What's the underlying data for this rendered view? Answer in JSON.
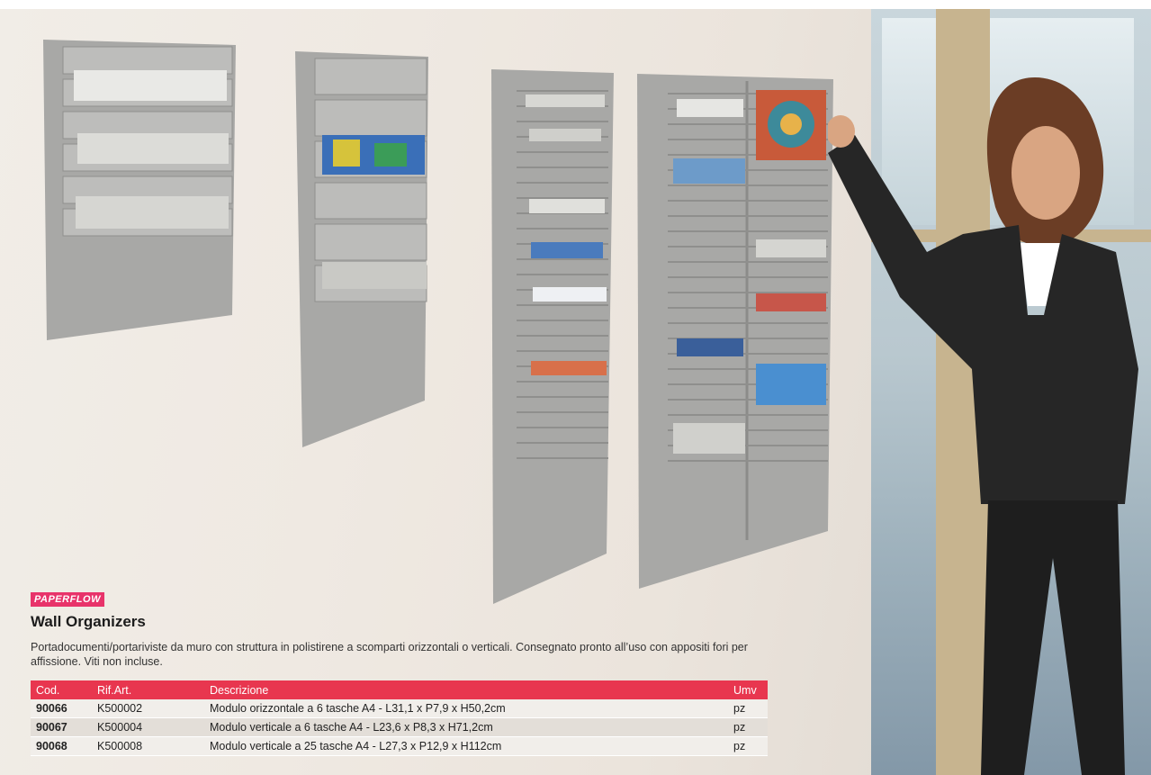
{
  "brand": "PAPERFLOW",
  "title": "Wall Organizers",
  "description": "Portadocumenti/portariviste da muro con struttura in polistirene a scomparti orizzontali o verticali. Consegnato pronto all’uso con appositi fori per affissione. Viti non incluse.",
  "table": {
    "headers": {
      "cod": "Cod.",
      "rif": "Rif.Art.",
      "desc": "Descrizione",
      "umv": "Umv"
    },
    "rows": [
      {
        "cod": "90066",
        "rif": "K500002",
        "desc": "Modulo orizzontale a 6 tasche A4 - L31,1 x P7,9 x H50,2cm",
        "umv": "pz"
      },
      {
        "cod": "90067",
        "rif": "K500004",
        "desc": "Modulo verticale a 6 tasche A4 - L23,6 x P8,3 x H71,2cm",
        "umv": "pz"
      },
      {
        "cod": "90068",
        "rif": "K500008",
        "desc": "Modulo verticale a 25 tasche A4 - L27,3 x P12,9 x H112cm",
        "umv": "pz"
      }
    ]
  },
  "colors": {
    "accent": "#e8364f",
    "brand_bg": "#e8336a",
    "rack": "#a9a9a7"
  }
}
